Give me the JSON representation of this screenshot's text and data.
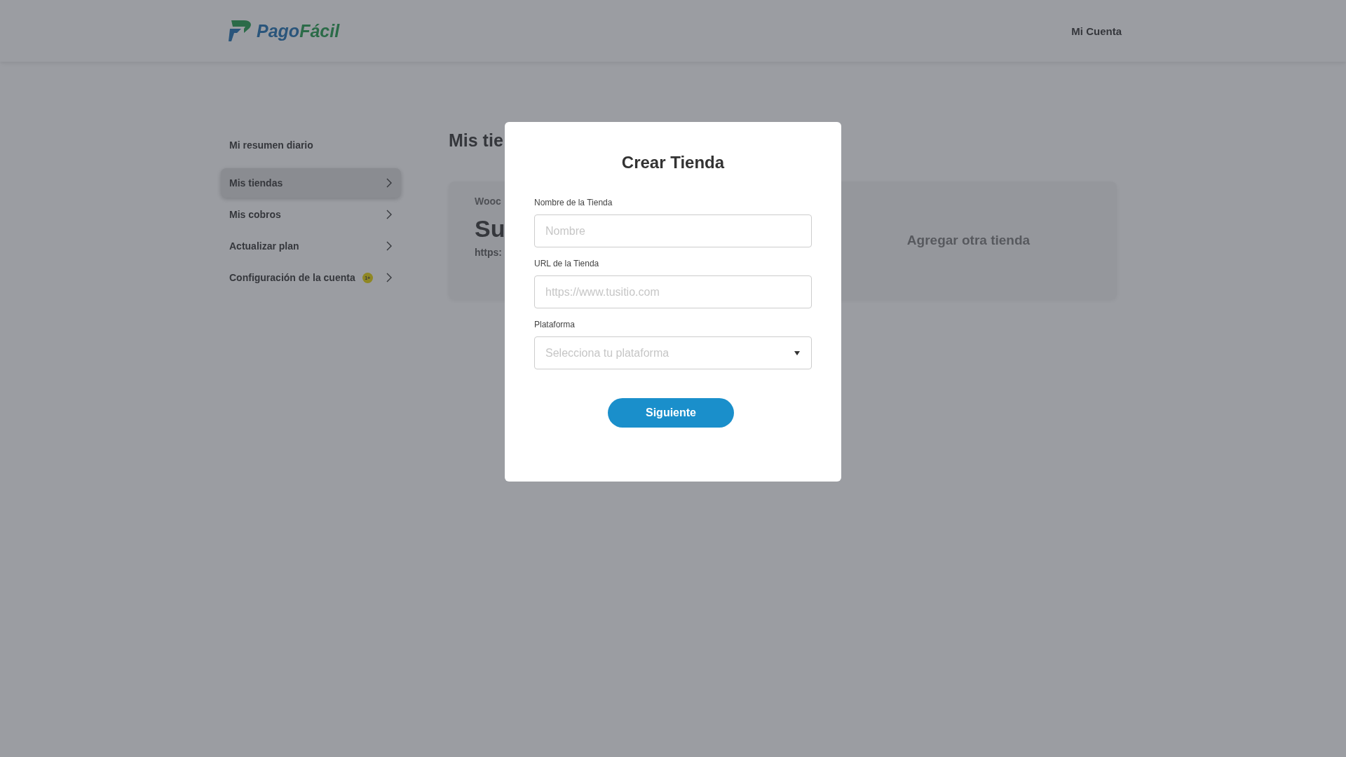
{
  "header": {
    "logo": {
      "part1": "Pago",
      "part2": "Fácil"
    },
    "account_link": "Mi Cuenta"
  },
  "sidebar": {
    "items": [
      {
        "label": "Mi resumen diario",
        "selected": false,
        "kind": "plain"
      },
      {
        "label": "Mis tiendas",
        "selected": true,
        "kind": "arrow"
      },
      {
        "label": "Mis cobros",
        "selected": false,
        "kind": "arrow"
      },
      {
        "label": "Actualizar plan",
        "selected": false,
        "kind": "arrow"
      },
      {
        "label": "Configuración de la cuenta",
        "selected": false,
        "kind": "arrow",
        "badge": "1+"
      }
    ]
  },
  "main": {
    "heading": "Mis tie",
    "store_card": {
      "platform": "Wooc",
      "name": "Su",
      "url": "https:"
    },
    "add_card": {
      "label": "Agregar otra tienda"
    }
  },
  "modal": {
    "title": "Crear Tienda",
    "fields": [
      {
        "label": "Nombre de la Tienda",
        "placeholder": "Nombre",
        "kind": "text"
      },
      {
        "label": "URL de la Tienda",
        "placeholder": "https://www.tusitio.com",
        "kind": "text"
      },
      {
        "label": "Plataforma",
        "placeholder": "Selecciona tu plataforma",
        "kind": "select"
      }
    ],
    "button": "Siguiente"
  }
}
